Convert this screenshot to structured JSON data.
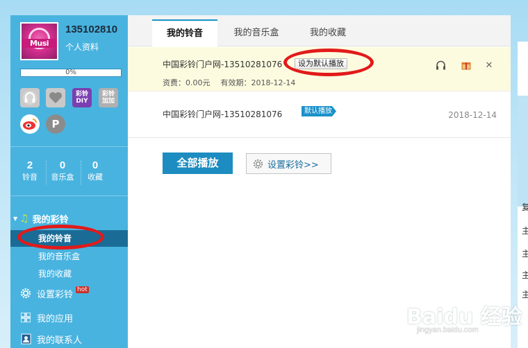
{
  "user": {
    "name": "135102810",
    "profile_link": "个人资料",
    "avatar_text": "Musi",
    "progress_text": "0%",
    "progress": 0
  },
  "quick_icons": [
    {
      "name": "headset-icon",
      "label": ""
    },
    {
      "name": "heart-icon",
      "label": ""
    },
    {
      "name": "ring-diy-icon",
      "label": "彩铃\nDIY"
    },
    {
      "name": "ring-add-icon",
      "label": "彩铃\n加加"
    },
    {
      "name": "weibo-icon",
      "label": ""
    },
    {
      "name": "p-search-icon",
      "label": ""
    }
  ],
  "stats": [
    {
      "count": "2",
      "label": "铃音"
    },
    {
      "count": "0",
      "label": "音乐盒"
    },
    {
      "count": "0",
      "label": "收藏"
    }
  ],
  "nav": {
    "section_title": "我的彩铃",
    "sub_items": [
      "我的铃音",
      "我的音乐盒",
      "我的收藏"
    ],
    "items": [
      {
        "label": "设置彩铃",
        "hot": "hot",
        "icon": "gear-icon"
      },
      {
        "label": "我的应用",
        "icon": "apps-grid-icon"
      },
      {
        "label": "我的联系人",
        "icon": "contacts-icon"
      }
    ]
  },
  "tabs": [
    "我的铃音",
    "我的音乐盒",
    "我的收藏"
  ],
  "rings": [
    {
      "title": "中国彩铃门户网-13510281076",
      "set_default_label": "设为默认播放",
      "fee_label": "资费：0.00元",
      "validity_label": "有效期：2018-12-14"
    },
    {
      "title": "中国彩铃门户网-13510281076",
      "badge": "默认播放",
      "date": "2018-12-14"
    }
  ],
  "actions": {
    "play_all": "全部播放",
    "set_ring": "设置彩铃>>"
  },
  "watermark": {
    "brand": "Baidu 经验",
    "url": "jingyan.baidu.com"
  },
  "right_strip_chars": [
    "复",
    "主",
    "主",
    "主",
    "主"
  ],
  "colors": {
    "sidebar": "#49b3df",
    "accent": "#1d8cc0",
    "highlight_row": "#fdfbdf",
    "annotation": "#e21a1a"
  }
}
